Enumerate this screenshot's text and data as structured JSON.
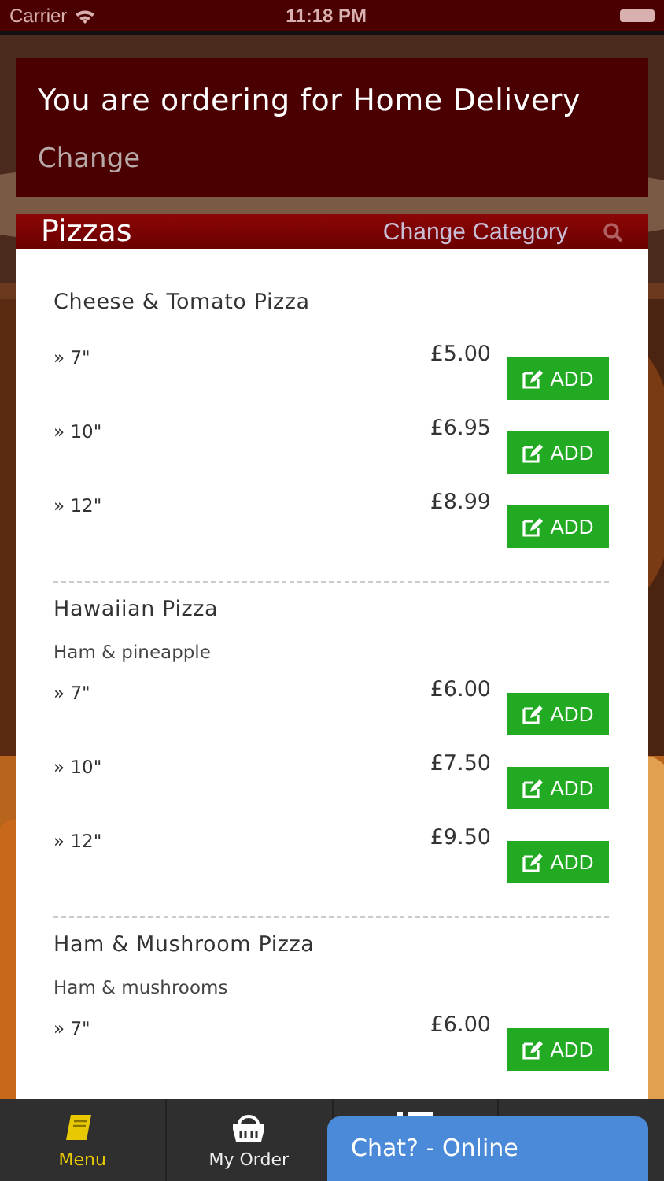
{
  "status_bar": {
    "carrier": "Carrier",
    "time": "11:18 PM"
  },
  "order_banner": {
    "title": "You are ordering for Home Delivery",
    "link": "Change"
  },
  "category_header": {
    "title": "Pizzas",
    "link": "Change Category"
  },
  "products": [
    {
      "name": "Cheese & Tomato Pizza",
      "options": [
        {
          "size": "» 7\"",
          "price": "£5.00",
          "button": "ADD"
        },
        {
          "size": "» 10\"",
          "price": "£6.95",
          "button": "ADD"
        },
        {
          "size": "» 12\"",
          "price": "£8.99",
          "button": "ADD"
        }
      ]
    },
    {
      "name": "Hawaiian Pizza",
      "description": "Ham & pineapple",
      "options": [
        {
          "size": "» 7\"",
          "price": "£6.00",
          "button": "ADD"
        },
        {
          "size": "» 10\"",
          "price": "£7.50",
          "button": "ADD"
        },
        {
          "size": "» 12\"",
          "price": "£9.50",
          "button": "ADD"
        }
      ]
    },
    {
      "name": "Ham & Mushroom Pizza",
      "description": "Ham & mushrooms",
      "options": [
        {
          "size": "» 7\"",
          "price": "£6.00",
          "button": "ADD"
        }
      ]
    }
  ],
  "tab_bar": [
    {
      "kind": "menu",
      "label": "Menu",
      "selected": true
    },
    {
      "kind": "order",
      "label": "My Order",
      "selected": false
    },
    {
      "kind": "list"
    }
  ],
  "chat_button": {
    "label": "Chat? - Online"
  }
}
